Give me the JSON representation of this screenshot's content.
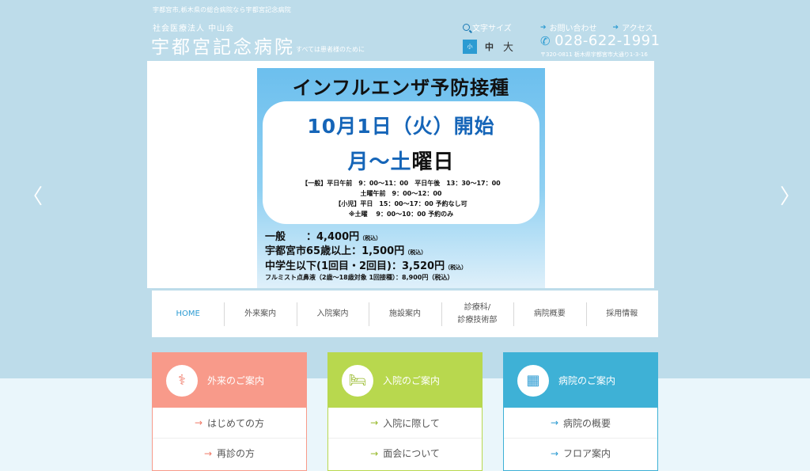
{
  "header": {
    "tagline": "宇都宮市,栃木県の総合病院なら宇都宮記念病院",
    "corp": "社会医療法人 中山会",
    "hospital_name": "宇都宮記念病院",
    "hospital_sub": "すべては患者様のために",
    "fontsize": {
      "label": "文字サイズ",
      "small": "小",
      "medium": "中",
      "large": "大"
    },
    "links": [
      {
        "label": "お問い合わせ"
      },
      {
        "label": "アクセス"
      }
    ],
    "phone": "028-622-1991",
    "address": "〒320-0811 栃木県宇都宮市大通り1-3-16"
  },
  "slider": {
    "prev": "〈",
    "next": "〉",
    "poster": {
      "title": "インフルエンザ予防接種",
      "date": "10月1日（火）開始",
      "days_blue": "月～土",
      "days_black": "曜日",
      "schedule": [
        "【一般】平日午前　9：00～11：00　平日午後　13：30～17：00",
        "土曜午前　9：00～12：00",
        "【小児】平日　15：00～17：00 予約なし可",
        "※土曜　 9：00～10：00 予約のみ"
      ],
      "prices": [
        {
          "text": "一般　　：4,400円",
          "note": "（税込）"
        },
        {
          "text": "宇都宮市65歳以上：1,500円",
          "note": "（税込）"
        },
        {
          "text": "中学生以下(1回目・2回目)：3,520円",
          "note": "（税込）"
        },
        {
          "text": "フルミスト点鼻液（2歳～18歳対象 1回接種）：8,900円（税込）",
          "note": ""
        }
      ]
    }
  },
  "nav": {
    "items": [
      {
        "label": "HOME"
      },
      {
        "label": "外来案内"
      },
      {
        "label": "入院案内"
      },
      {
        "label": "施設案内"
      },
      {
        "label": "診療科/\n診療技術部"
      },
      {
        "label": "病院概要"
      },
      {
        "label": "採用情報"
      }
    ]
  },
  "cards": [
    {
      "title": "外来のご案内",
      "links": [
        "はじめての方",
        "再診の方"
      ],
      "icon": "stethoscope-icon"
    },
    {
      "title": "入院のご案内",
      "links": [
        "入院に際して",
        "面会について"
      ],
      "icon": "bed-icon"
    },
    {
      "title": "病院のご案内",
      "links": [
        "病院の概要",
        "フロア案内"
      ],
      "icon": "building-icon"
    }
  ],
  "colors": {
    "accent": "#2c9bd2",
    "pink": "#f89a8a",
    "green": "#b8d84e",
    "blue": "#3eb1d6"
  }
}
